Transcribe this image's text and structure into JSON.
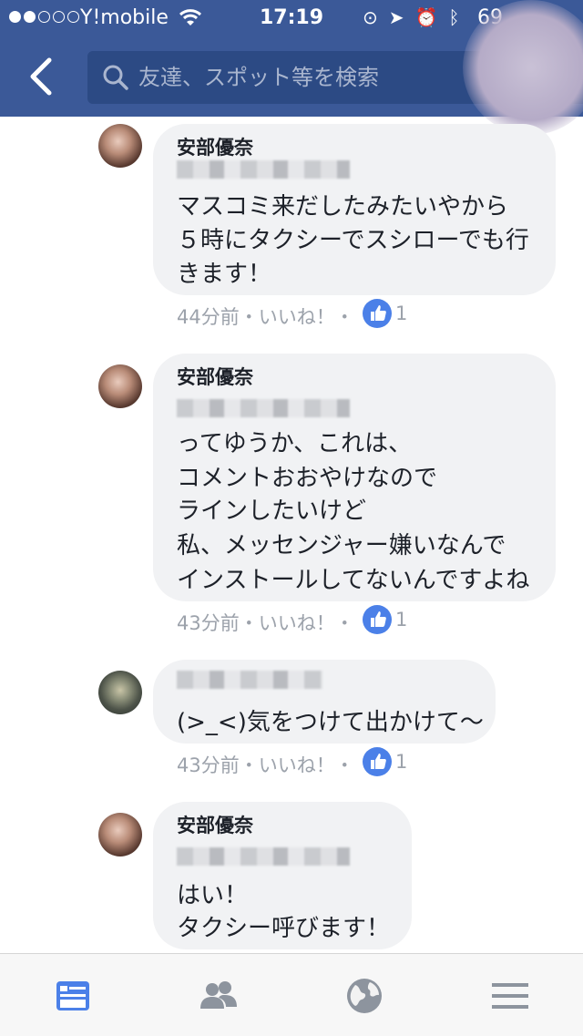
{
  "status_bar": {
    "carrier": "Y!mobile",
    "time": "17:19",
    "battery": "69"
  },
  "search": {
    "placeholder": "友達、スポット等を検索"
  },
  "comments": [
    {
      "author": "安部優奈",
      "lines": [
        "マスコミ来だしたみたいやから",
        "５時にタクシーでスシローでも行",
        "きます！"
      ],
      "time": "44分前",
      "like_label": "いいね！",
      "likes": "1"
    },
    {
      "author": "安部優奈",
      "lines": [
        "ってゆうか、これは、",
        "コメントおおやけなので",
        "ラインしたいけど",
        "私、メッセンジャー嫌いなんで",
        "インストールしてないんですよね"
      ],
      "time": "43分前",
      "like_label": "いいね！",
      "likes": "1"
    },
    {
      "author": "",
      "lines": [
        "(>_<)気をつけて出かけて～"
      ],
      "time": "43分前",
      "like_label": "いいね！",
      "likes": "1"
    },
    {
      "author": "安部優奈",
      "lines": [
        "はい！",
        "タクシー呼びます！"
      ]
    }
  ],
  "tabs": [
    {
      "icon": "news-feed-icon",
      "active": true
    },
    {
      "icon": "friends-icon",
      "active": false
    },
    {
      "icon": "globe-icon",
      "active": false
    },
    {
      "icon": "menu-icon",
      "active": false
    }
  ],
  "colors": {
    "brand": "#3b5998",
    "like_blue": "#4b80e8",
    "bubble": "#f1f2f4",
    "meta": "#9ca2ab"
  }
}
